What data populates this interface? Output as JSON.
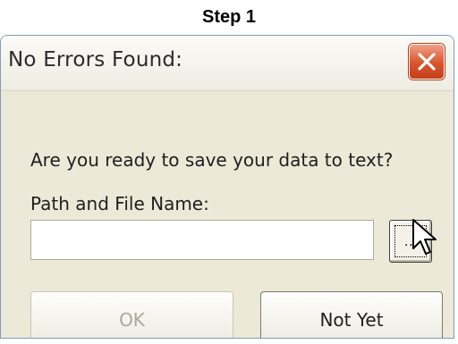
{
  "caption": "Step 1",
  "dialog": {
    "title": "No Errors Found:",
    "prompt": "Are you ready to save your data to text?",
    "path_label": "Path and File Name:",
    "path_value": "",
    "browse_label": "...",
    "ok_label": "OK",
    "not_yet_label": "Not Yet",
    "ok_disabled": true
  },
  "icons": {
    "close": "close-icon",
    "cursor": "mouse-cursor-icon"
  },
  "colors": {
    "close_button": "#d8542c",
    "dialog_background": "#ece9d8",
    "disabled_text": "#aca899"
  }
}
